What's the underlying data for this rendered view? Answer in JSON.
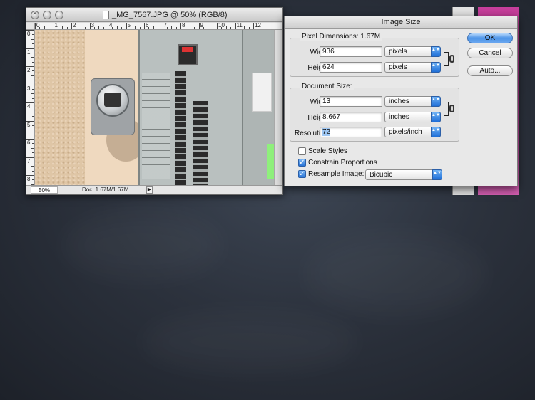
{
  "document_window": {
    "title": "_MG_7567.JPG @ 50% (RGB/8)",
    "ruler_h_labels": [
      "0",
      "1",
      "2",
      "3",
      "4",
      "5",
      "6",
      "7",
      "8",
      "9",
      "10",
      "11",
      "12"
    ],
    "ruler_v_labels": [
      "0",
      "1",
      "2",
      "3",
      "4",
      "5",
      "6",
      "7",
      "8"
    ],
    "zoom": "50%",
    "doc_info": "Doc: 1.67M/1.67M",
    "status_menu_glyph": "▶"
  },
  "dialog": {
    "title": "Image Size",
    "pixel_dimensions": {
      "title": "Pixel Dimensions:",
      "size": "1.67M",
      "width_label": "Width:",
      "width_value": "936",
      "width_unit": "pixels",
      "height_label": "Height:",
      "height_value": "624",
      "height_unit": "pixels"
    },
    "document_size": {
      "title": "Document Size:",
      "width_label": "Width:",
      "width_value": "13",
      "width_unit": "inches",
      "height_label": "Height:",
      "height_value": "8.667",
      "height_unit": "inches",
      "resolution_label": "Resolution:",
      "resolution_value": "72",
      "resolution_unit": "pixels/inch"
    },
    "checkboxes": {
      "scale_styles": {
        "label": "Scale Styles",
        "checked": false
      },
      "constrain_proportions": {
        "label": "Constrain Proportions",
        "checked": true
      },
      "resample_image": {
        "label": "Resample Image:",
        "checked": true
      }
    },
    "resample_method": "Bicubic",
    "buttons": {
      "ok": "OK",
      "cancel": "Cancel",
      "auto": "Auto..."
    },
    "checkmark": "✓",
    "select_arrows": "▲▼"
  },
  "colors": {
    "accent_blue": "#2a74d6",
    "background": "#2c323d",
    "pink_strip": "#c83f9c"
  }
}
